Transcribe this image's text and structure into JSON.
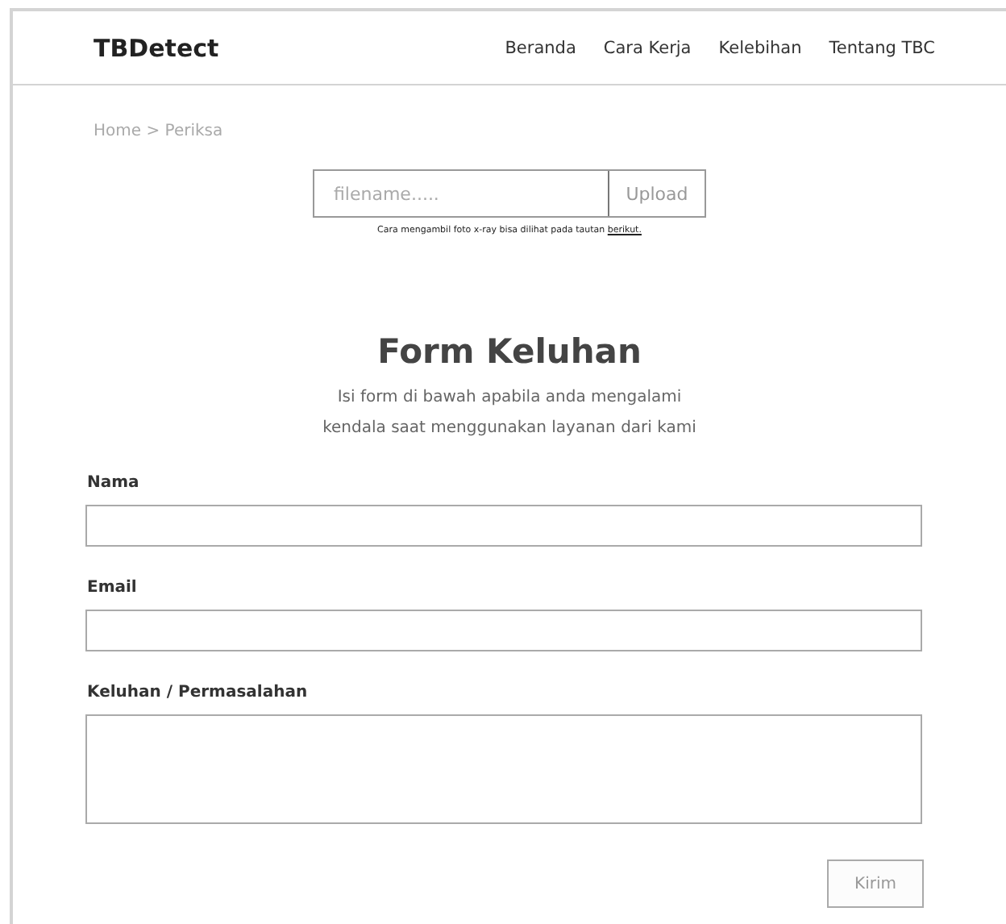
{
  "header": {
    "logo": "TBDetect",
    "nav": [
      {
        "label": "Beranda"
      },
      {
        "label": "Cara Kerja"
      },
      {
        "label": "Kelebihan"
      },
      {
        "label": "Tentang TBC"
      }
    ]
  },
  "breadcrumb": "Home > Periksa",
  "upload": {
    "placeholder": "filename.....",
    "button": "Upload",
    "hint": "Cara mengambil foto x-ray bisa dilihat pada tautan",
    "hint_link": "berikut."
  },
  "form": {
    "title": "Form Keluhan",
    "subtitle_lines": [
      "Isi form di bawah apabila anda mengalami",
      "kendala saat menggunakan layanan dari kami"
    ],
    "fields": [
      {
        "label": "Nama",
        "kind": "input"
      },
      {
        "label": "Email",
        "kind": "input"
      },
      {
        "label": "Keluhan / Permasalahan",
        "kind": "textarea"
      }
    ],
    "submit": "Kirim"
  }
}
